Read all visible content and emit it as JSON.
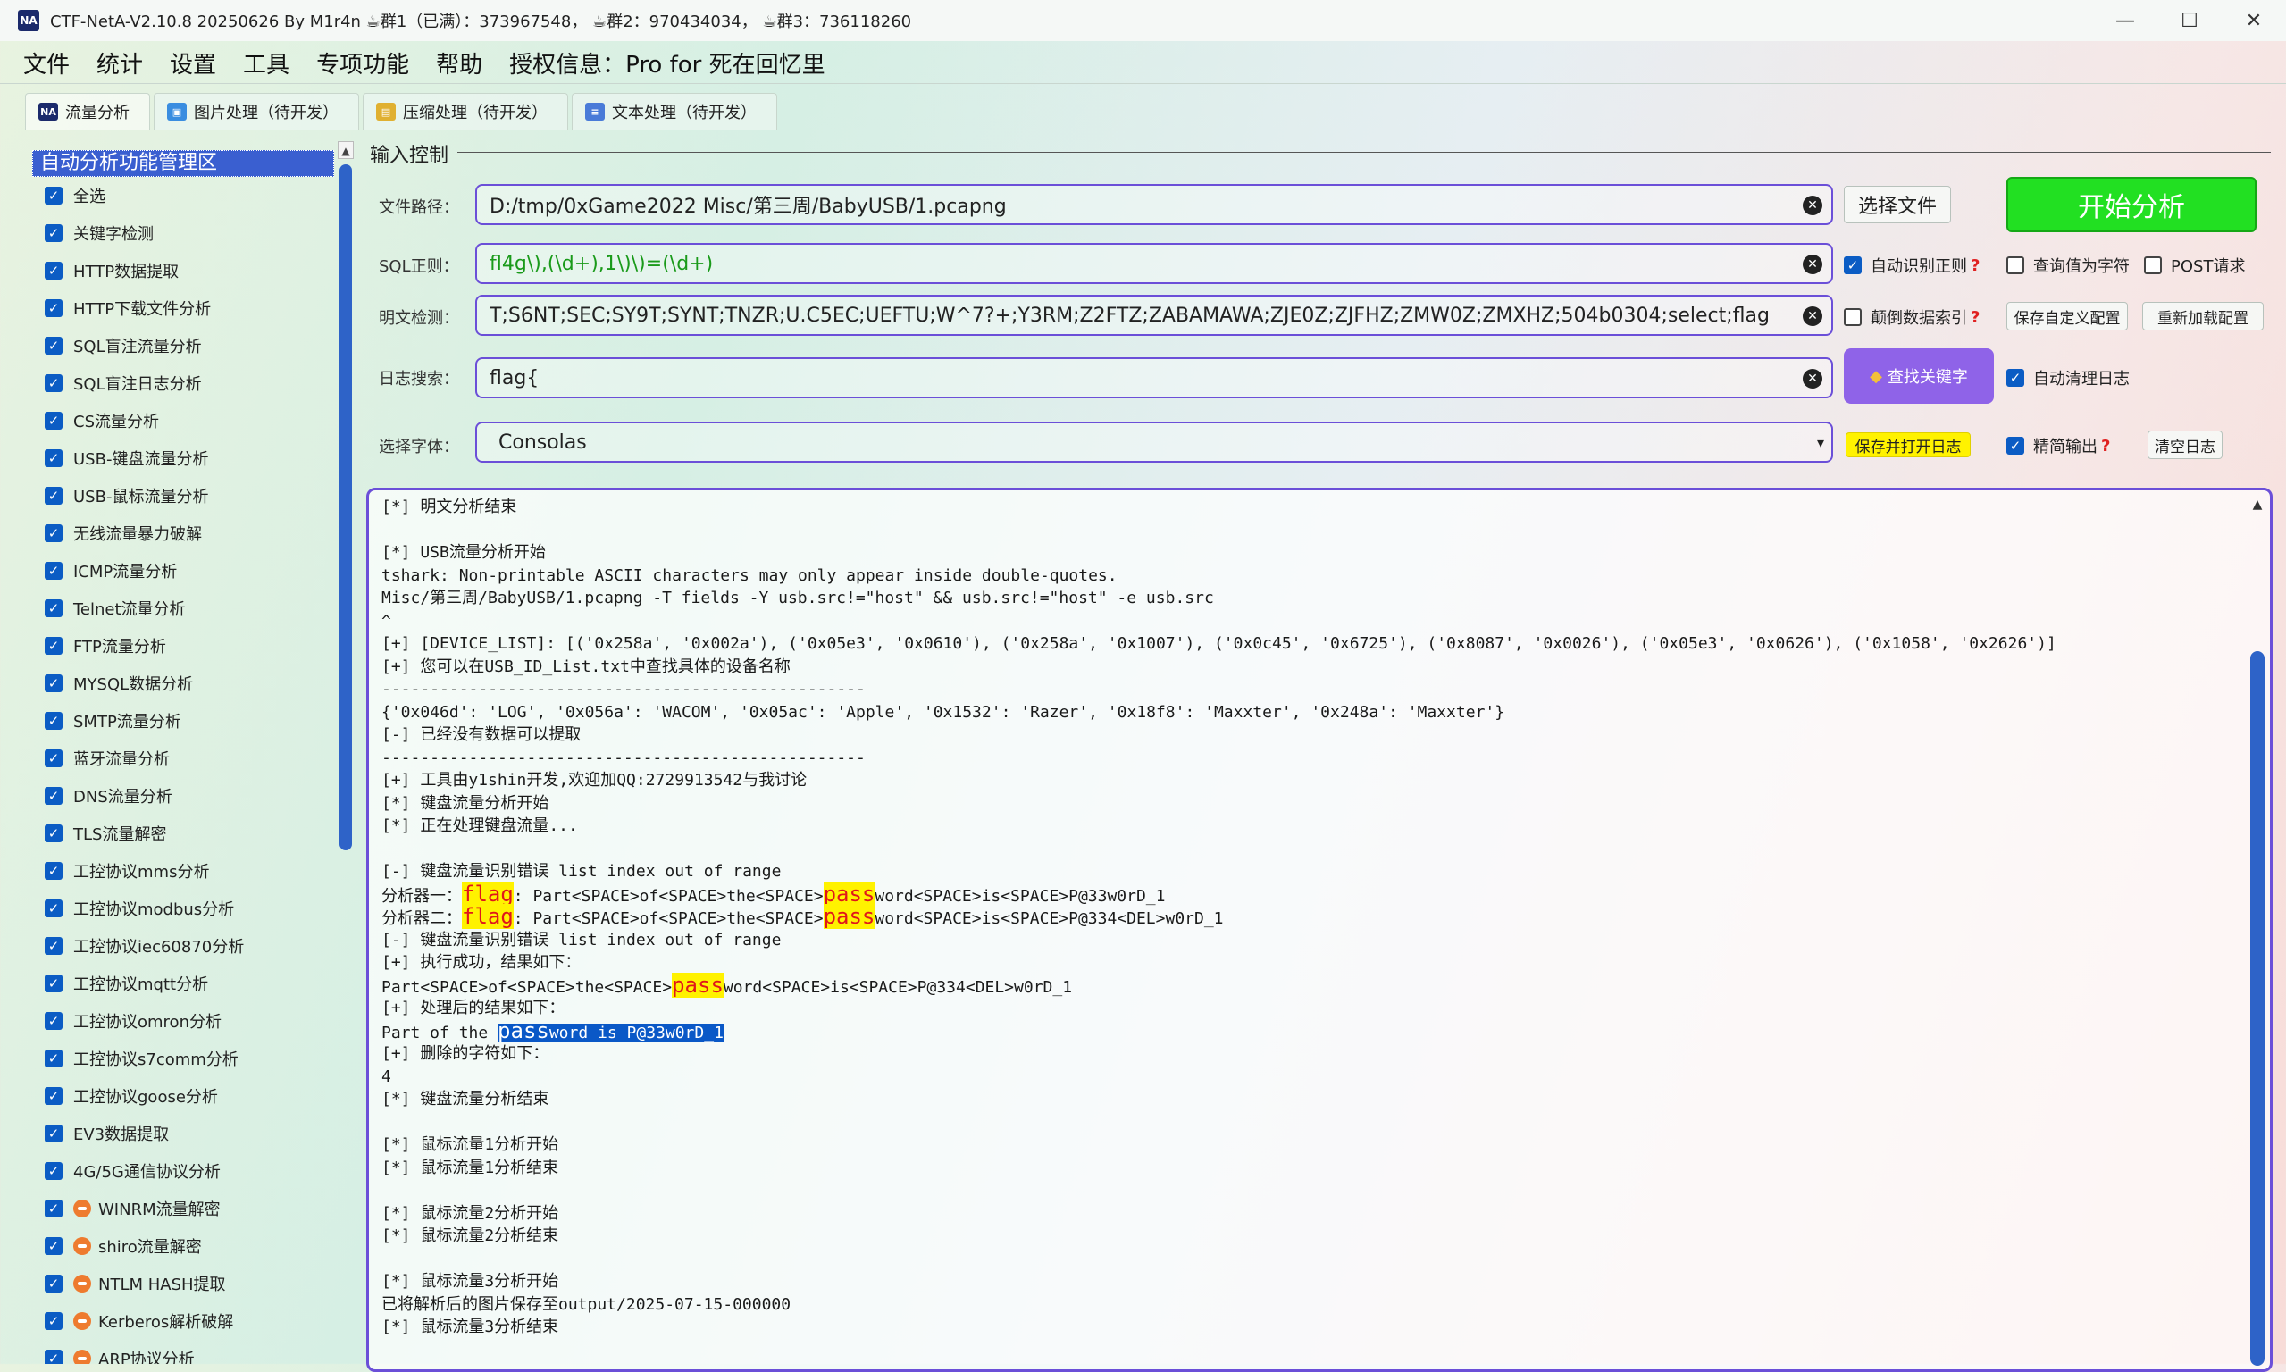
{
  "window": {
    "title": "CTF-NetA-V2.10.8 20250626 By M1r4n ☕群1（已满）：373967548， ☕群2：970434034， ☕群3：736118260",
    "app_icon": "NA",
    "controls": [
      "—",
      "☐",
      "✕"
    ]
  },
  "menu": [
    "文件",
    "统计",
    "设置",
    "工具",
    "专项功能",
    "帮助",
    "授权信息：Pro for 死在回忆里"
  ],
  "tabs": [
    {
      "label": "流量分析",
      "icon": "na-icon"
    },
    {
      "label": "图片处理（待开发）",
      "icon": "image-icon"
    },
    {
      "label": "压缩处理（待开发）",
      "icon": "archive-icon"
    },
    {
      "label": "文本处理（待开发）",
      "icon": "text-icon"
    }
  ],
  "sidebar": {
    "title": "自动分析功能管理区",
    "items": [
      {
        "label": "全选",
        "badge": false
      },
      {
        "label": "关键字检测",
        "badge": false
      },
      {
        "label": "HTTP数据提取",
        "badge": false
      },
      {
        "label": "HTTP下载文件分析",
        "badge": false
      },
      {
        "label": "SQL盲注流量分析",
        "badge": false
      },
      {
        "label": "SQL盲注日志分析",
        "badge": false
      },
      {
        "label": "CS流量分析",
        "badge": false
      },
      {
        "label": "USB-键盘流量分析",
        "badge": false
      },
      {
        "label": "USB-鼠标流量分析",
        "badge": false
      },
      {
        "label": "无线流量暴力破解",
        "badge": false
      },
      {
        "label": "ICMP流量分析",
        "badge": false
      },
      {
        "label": "Telnet流量分析",
        "badge": false
      },
      {
        "label": "FTP流量分析",
        "badge": false
      },
      {
        "label": "MYSQL数据分析",
        "badge": false
      },
      {
        "label": "SMTP流量分析",
        "badge": false
      },
      {
        "label": "蓝牙流量分析",
        "badge": false
      },
      {
        "label": "DNS流量分析",
        "badge": false
      },
      {
        "label": "TLS流量解密",
        "badge": false
      },
      {
        "label": "工控协议mms分析",
        "badge": false
      },
      {
        "label": "工控协议modbus分析",
        "badge": false
      },
      {
        "label": "工控协议iec60870分析",
        "badge": false
      },
      {
        "label": "工控协议mqtt分析",
        "badge": false
      },
      {
        "label": "工控协议omron分析",
        "badge": false
      },
      {
        "label": "工控协议s7comm分析",
        "badge": false
      },
      {
        "label": "工控协议goose分析",
        "badge": false
      },
      {
        "label": "EV3数据提取",
        "badge": false
      },
      {
        "label": "4G/5G通信协议分析",
        "badge": false
      },
      {
        "label": "WINRM流量解密",
        "badge": true
      },
      {
        "label": "shiro流量解密",
        "badge": true
      },
      {
        "label": "NTLM HASH提取",
        "badge": true
      },
      {
        "label": "Kerberos解析破解",
        "badge": true
      },
      {
        "label": "ARP协议分析",
        "badge": true
      }
    ]
  },
  "input_control": {
    "group_title": "输入控制",
    "file_path": {
      "label": "文件路径：",
      "value": "D:/tmp/0xGame2022 Misc/第三周/BabyUSB/1.pcapng"
    },
    "sql_regex": {
      "label": "SQL正则：",
      "value": "fl4g\\),(\\d+),1\\)\\)=(\\d+)"
    },
    "plaintext": {
      "label": "明文检测：",
      "value": "T;S6NT;SEC;SY9T;SYNT;TNZR;U.C5EC;UEFTU;W^7?+;Y3RM;Z2FTZ;ZABAMAWA;ZJE0Z;ZJFHZ;ZMW0Z;ZMXHZ;504b0304;select;flag"
    },
    "log_search": {
      "label": "日志搜索：",
      "value": "flag{"
    },
    "font_select": {
      "label": "选择字体：",
      "value": "Consolas"
    },
    "select_file_button": "选择文件",
    "start_button": "开始分析",
    "auto_regex": {
      "label": "自动识别正则",
      "checked": true,
      "help": "?"
    },
    "query_as_char": {
      "label": "查询值为字符",
      "checked": false
    },
    "post_request": {
      "label": "POST请求",
      "checked": false
    },
    "reverse_index": {
      "label": "颠倒数据索引",
      "checked": false,
      "help": "?"
    },
    "save_config_button": "保存自定义配置",
    "reload_config_button": "重新加载配置",
    "find_key_button": "查找关键字",
    "auto_clear_log": {
      "label": "自动清理日志",
      "checked": true
    },
    "save_open_log_button": "保存并打开日志",
    "concise_output": {
      "label": "精简输出",
      "checked": true,
      "help": "?"
    },
    "clear_log_button": "清空日志"
  },
  "log": [
    {
      "t": "[*] 明文分析结束"
    },
    {
      "t": ""
    },
    {
      "t": "[*] USB流量分析开始"
    },
    {
      "t": "tshark: Non-printable ASCII characters may only appear inside double-quotes."
    },
    {
      "t": "Misc/第三周/BabyUSB/1.pcapng -T fields -Y usb.src!=\"host\" && usb.src!=\"host\" -e usb.src"
    },
    {
      "t": "^"
    },
    {
      "t": "[+] [DEVICE_LIST]: [('0x258a', '0x002a'), ('0x05e3', '0x0610'), ('0x258a', '0x1007'), ('0x0c45', '0x6725'), ('0x8087', '0x0026'), ('0x05e3', '0x0626'), ('0x1058', '0x2626')]"
    },
    {
      "t": "[+] 您可以在USB_ID_List.txt中查找具体的设备名称"
    },
    {
      "t": "--------------------------------------------------"
    },
    {
      "t": "{'0x046d': 'LOG', '0x056a': 'WACOM', '0x05ac': 'Apple', '0x1532': 'Razer', '0x18f8': 'Maxxter', '0x248a': 'Maxxter'}"
    },
    {
      "t": "[-] 已经没有数据可以提取"
    },
    {
      "t": "--------------------------------------------------"
    },
    {
      "t": "[+] 工具由y1shin开发,欢迎加QQ:2729913542与我讨论"
    },
    {
      "t": "[*] 键盘流量分析开始"
    },
    {
      "t": "[*] 正在处理键盘流量..."
    },
    {
      "t": ""
    },
    {
      "t": "[-] 键盘流量识别错误 list index out of range"
    },
    {
      "pre": "分析器一：",
      "hl1": "flag",
      "mid": ": Part<SPACE>of<SPACE>the<SPACE>",
      "hl2": "pass",
      "post": "word<SPACE>is<SPACE>P@33w0rD_1"
    },
    {
      "pre": "分析器二：",
      "hl1": "flag",
      "mid": ": Part<SPACE>of<SPACE>the<SPACE>",
      "hl2": "pass",
      "post": "word<SPACE>is<SPACE>P@334<DEL>w0rD_1"
    },
    {
      "t": "[-] 键盘流量识别错误 list index out of range"
    },
    {
      "t": "[+] 执行成功，结果如下："
    },
    {
      "pre": "Part<SPACE>of<SPACE>the<SPACE>",
      "hl2": "pass",
      "post": "word<SPACE>is<SPACE>P@334<DEL>w0rD_1"
    },
    {
      "t": "[+] 处理后的结果如下："
    },
    {
      "pre": "Part of the ",
      "sel_big": "pass",
      "sel": "word is P@33w0rD_1"
    },
    {
      "t": "[+] 删除的字符如下："
    },
    {
      "t": "4"
    },
    {
      "t": "[*] 键盘流量分析结束"
    },
    {
      "t": ""
    },
    {
      "t": "[*] 鼠标流量1分析开始"
    },
    {
      "t": "[*] 鼠标流量1分析结束"
    },
    {
      "t": ""
    },
    {
      "t": "[*] 鼠标流量2分析开始"
    },
    {
      "t": "[*] 鼠标流量2分析结束"
    },
    {
      "t": ""
    },
    {
      "t": "[*] 鼠标流量3分析开始"
    },
    {
      "t": "已将解析后的图片保存至output/2025-07-15-000000"
    },
    {
      "t": "[*] 鼠标流量3分析结束"
    }
  ],
  "colors": {
    "accent": "#6b4fd8",
    "start_button": "#22e022",
    "find_button": "#8f63e8",
    "highlight": "#fff200",
    "checkbox": "#0b5cc4"
  }
}
